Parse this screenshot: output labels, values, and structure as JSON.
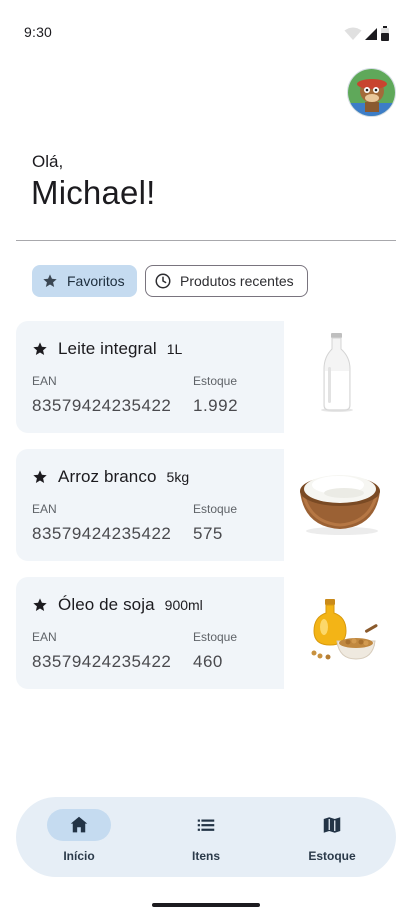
{
  "status_bar": {
    "time": "9:30"
  },
  "greeting": {
    "hello": "Olá,",
    "name": "Michael!"
  },
  "chips": {
    "favorites": {
      "label": "Favoritos",
      "icon": "star-icon"
    },
    "recent": {
      "label": "Produtos recentes",
      "icon": "clock-icon"
    }
  },
  "products": [
    {
      "name": "Leite integral",
      "size": "1L",
      "ean_label": "EAN",
      "ean": "83579424235422",
      "stock_label": "Estoque",
      "stock": "1.992",
      "image": "milk-bottle"
    },
    {
      "name": "Arroz branco",
      "size": "5kg",
      "ean_label": "EAN",
      "ean": "83579424235422",
      "stock_label": "Estoque",
      "stock": "575",
      "image": "rice-bowl"
    },
    {
      "name": "Óleo de soja",
      "size": "900ml",
      "ean_label": "EAN",
      "ean": "83579424235422",
      "stock_label": "Estoque",
      "stock": "460",
      "image": "soy-oil"
    }
  ],
  "nav": {
    "items": [
      {
        "label": "Início",
        "icon": "home-icon",
        "active": true
      },
      {
        "label": "Itens",
        "icon": "list-icon",
        "active": false
      },
      {
        "label": "Estoque",
        "icon": "map-icon",
        "active": false
      }
    ]
  },
  "colors": {
    "chip_active": "#c5dbf0",
    "card_bg": "#f1f5f9",
    "nav_bg": "#e6eef6"
  }
}
